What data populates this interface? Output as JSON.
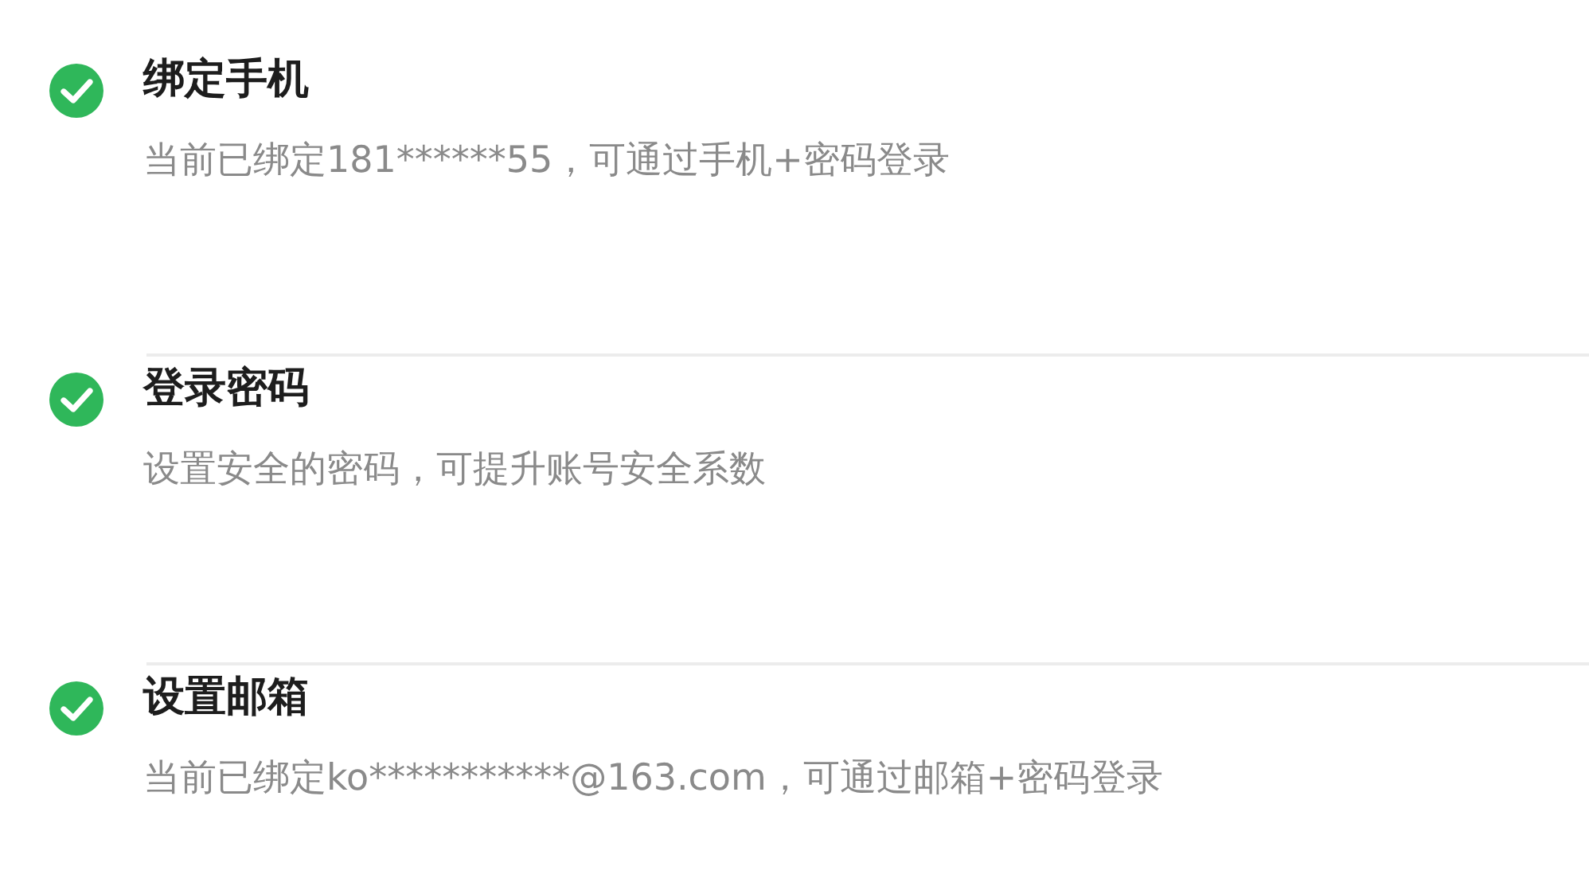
{
  "items": [
    {
      "title": "绑定手机",
      "description": "当前已绑定181******55，可通过手机+密码登录",
      "done": true
    },
    {
      "title": "登录密码",
      "description": "设置安全的密码，可提升账号安全系数",
      "done": true
    },
    {
      "title": "设置邮箱",
      "description": "当前已绑定ko***********@163.com，可通过邮箱+密码登录",
      "done": true
    }
  ]
}
